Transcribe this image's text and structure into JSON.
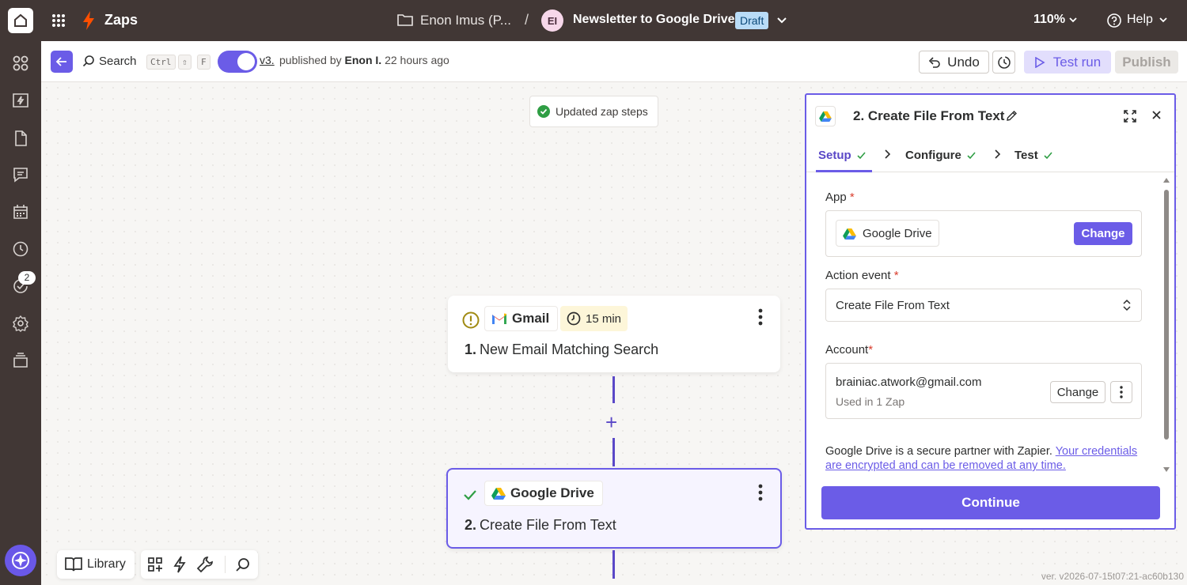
{
  "topbar": {
    "app_name": "Zaps",
    "folder_name": "Enon Imus (P...",
    "separator": "/",
    "avatar_initials": "EI",
    "zap_title": "Newsletter to Google Drive",
    "status_badge": "Draft",
    "zoom": "110%",
    "help_label": "Help"
  },
  "left_rail": {
    "items": [
      "apps-icon",
      "zap-icon",
      "file-icon",
      "chat-icon",
      "calendar-icon",
      "history-icon",
      "activity-icon",
      "settings-icon",
      "stack-icon"
    ],
    "notification_badge": "2"
  },
  "toolbar": {
    "search_label": "Search",
    "shortcut_keys": [
      "Ctrl",
      "⇧",
      "F"
    ],
    "version_link": "v3.",
    "published_prefix": "published by",
    "publisher": "Enon I.",
    "published_time": "22 hours ago",
    "undo_label": "Undo",
    "test_run_label": "Test run",
    "publish_label": "Publish"
  },
  "canvas": {
    "toast": "Updated zap steps",
    "steps": [
      {
        "number": "1.",
        "app": "Gmail",
        "timer": "15 min",
        "title": "New Email Matching Search",
        "status": "warning"
      },
      {
        "number": "2.",
        "app": "Google Drive",
        "title": "Create File From Text",
        "status": "complete"
      }
    ],
    "bottom_tools": {
      "library_label": "Library"
    },
    "version_text": "ver. v2026-07-15t07:21-ac60b130"
  },
  "panel": {
    "title": "2. Create File From Text",
    "tabs": [
      {
        "label": "Setup",
        "active": true
      },
      {
        "label": "Configure",
        "active": false
      },
      {
        "label": "Test",
        "active": false
      }
    ],
    "app_label": "App",
    "app_required": "*",
    "app_value": "Google Drive",
    "app_change": "Change",
    "action_event_label": "Action event",
    "action_event_required": "*",
    "action_event_value": "Create File From Text",
    "account_label": "Account",
    "account_required": "*",
    "account_email": "brainiac.atwork@gmail.com",
    "account_used": "Used in 1 Zap",
    "account_change": "Change",
    "partner_text": "Google Drive is a secure partner with Zapier.",
    "partner_link": "Your credentials are encrypted and can be removed at any time.",
    "continue_label": "Continue"
  },
  "colors": {
    "accent": "#6b5ce7",
    "topbar_bg": "#413735",
    "draft_badge": "#b9dcf7",
    "success": "#2f9e44",
    "warning": "#a08a12"
  }
}
